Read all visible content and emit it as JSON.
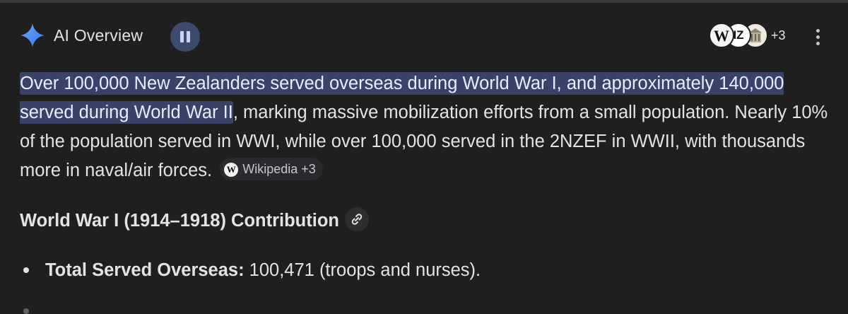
{
  "header": {
    "title": "AI Overview",
    "sources_extra": "+3",
    "source_avatars": [
      "W",
      "IZ",
      ""
    ]
  },
  "overview": {
    "highlighted_text": " Over 100,000 New Zealanders served overseas during World War I, and approximately 140,000 served during World War II",
    "rest_text": ", marking massive mobilization efforts from a small population. Nearly 10% of the population served in WWI, while over 100,000 served in the 2NZEF in WWII, with thousands more in naval/air forces.",
    "citation_chip": {
      "icon": "W",
      "label": "Wikipedia +3"
    }
  },
  "section": {
    "title": "World War I (1914–1918) Contribution"
  },
  "bullets": [
    {
      "label": "Total Served Overseas:",
      "text": " 100,471 (troops and nurses)."
    },
    {
      "label": "",
      "text": ""
    }
  ],
  "colors": {
    "background": "#1f1f1f",
    "highlight": "#39436a",
    "sparkle_blue": "#4e8ef7",
    "pause_button": "#3c4a6b"
  }
}
